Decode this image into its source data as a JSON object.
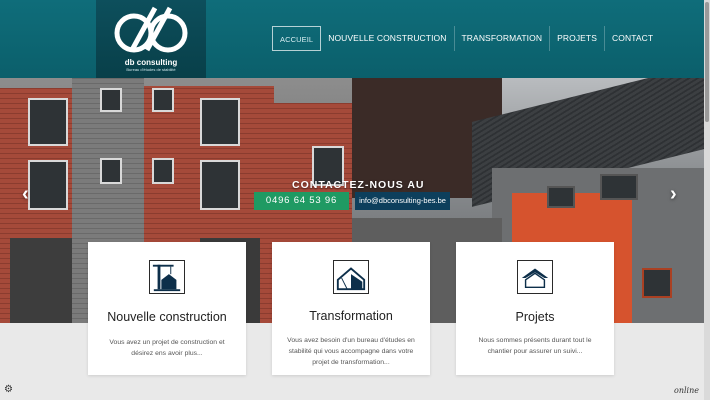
{
  "logo": {
    "name": "db consulting",
    "tagline": "Bureau d'études de stabilité"
  },
  "nav": [
    {
      "label": "ACCUEIL",
      "active": true
    },
    {
      "label": "NOUVELLE CONSTRUCTION",
      "active": false
    },
    {
      "label": "TRANSFORMATION",
      "active": false
    },
    {
      "label": "PROJETS",
      "active": false
    },
    {
      "label": "CONTACT",
      "active": false
    }
  ],
  "hero": {
    "heading": "CONTACTEZ-NOUS AU",
    "phone": "0496 64 53 96",
    "email": "info@dbconsulting-bes.be",
    "prev_icon": "chevron-left-icon",
    "next_icon": "chevron-right-icon"
  },
  "cards": [
    {
      "icon": "house-construction-icon",
      "title": "Nouvelle construction",
      "text": "Vous avez un projet de construction et désirez ens avoir plus..."
    },
    {
      "icon": "house-transformation-icon",
      "title": "Transformation",
      "text": "Vous avez besoin d'un bureau d'études en stabilité qui vous accompagne dans votre projet de transformation..."
    },
    {
      "icon": "roof-projects-icon",
      "title": "Projets",
      "text": "Nous sommes présents durant tout le chantier pour assurer un suivi..."
    }
  ],
  "footer": {
    "badge": "online",
    "cookie_icon": "gear-icon"
  },
  "colors": {
    "header": "#0f6d7a",
    "phone_button": "#1f9a63",
    "email_button": "#0d3f5c"
  }
}
